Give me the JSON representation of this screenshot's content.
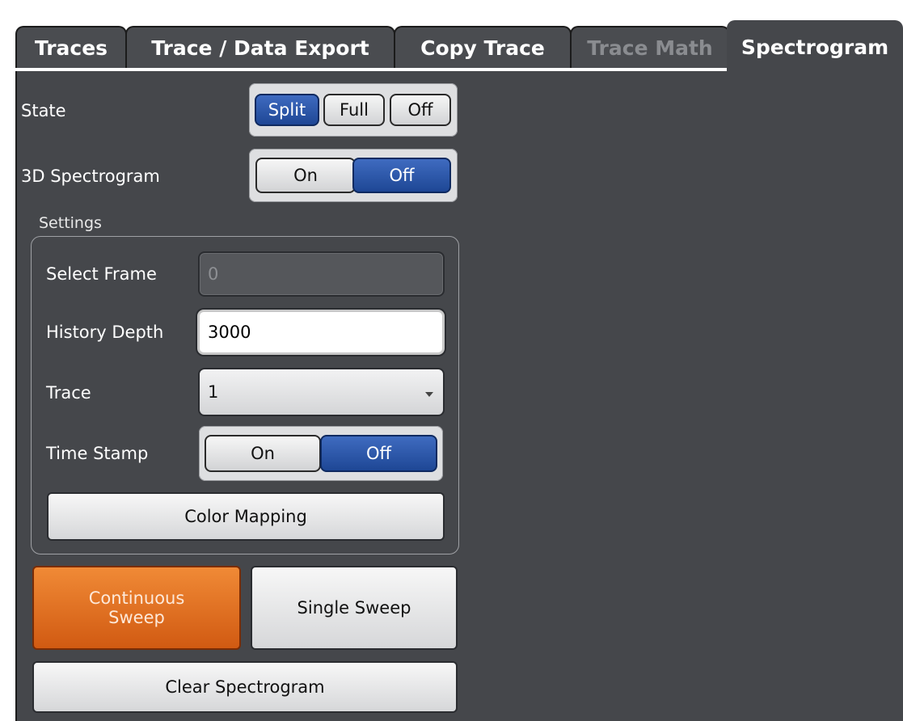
{
  "tabs": {
    "traces": "Traces",
    "export": "Trace / Data Export",
    "copy": "Copy Trace",
    "math": "Trace Math",
    "spectrogram": "Spectrogram"
  },
  "state": {
    "label": "State",
    "options": [
      "Split",
      "Full",
      "Off"
    ],
    "selected": "Split"
  },
  "spectrogram3d": {
    "label": "3D Spectrogram",
    "options": [
      "On",
      "Off"
    ],
    "selected": "Off"
  },
  "settings": {
    "title": "Settings",
    "select_frame": {
      "label": "Select Frame",
      "value": "0"
    },
    "history_depth": {
      "label": "History Depth",
      "value": "3000"
    },
    "trace": {
      "label": "Trace",
      "value": "1"
    },
    "time_stamp": {
      "label": "Time Stamp",
      "options": [
        "On",
        "Off"
      ],
      "selected": "Off"
    },
    "color_mapping": "Color Mapping"
  },
  "buttons": {
    "continuous_line1": "Continuous",
    "continuous_line2": "Sweep",
    "single": "Single Sweep",
    "clear": "Clear Spectrogram"
  },
  "colors": {
    "panel_bg": "#45474b",
    "selected_blue": "#2a55a8",
    "continuous_orange": "#e0701e"
  }
}
